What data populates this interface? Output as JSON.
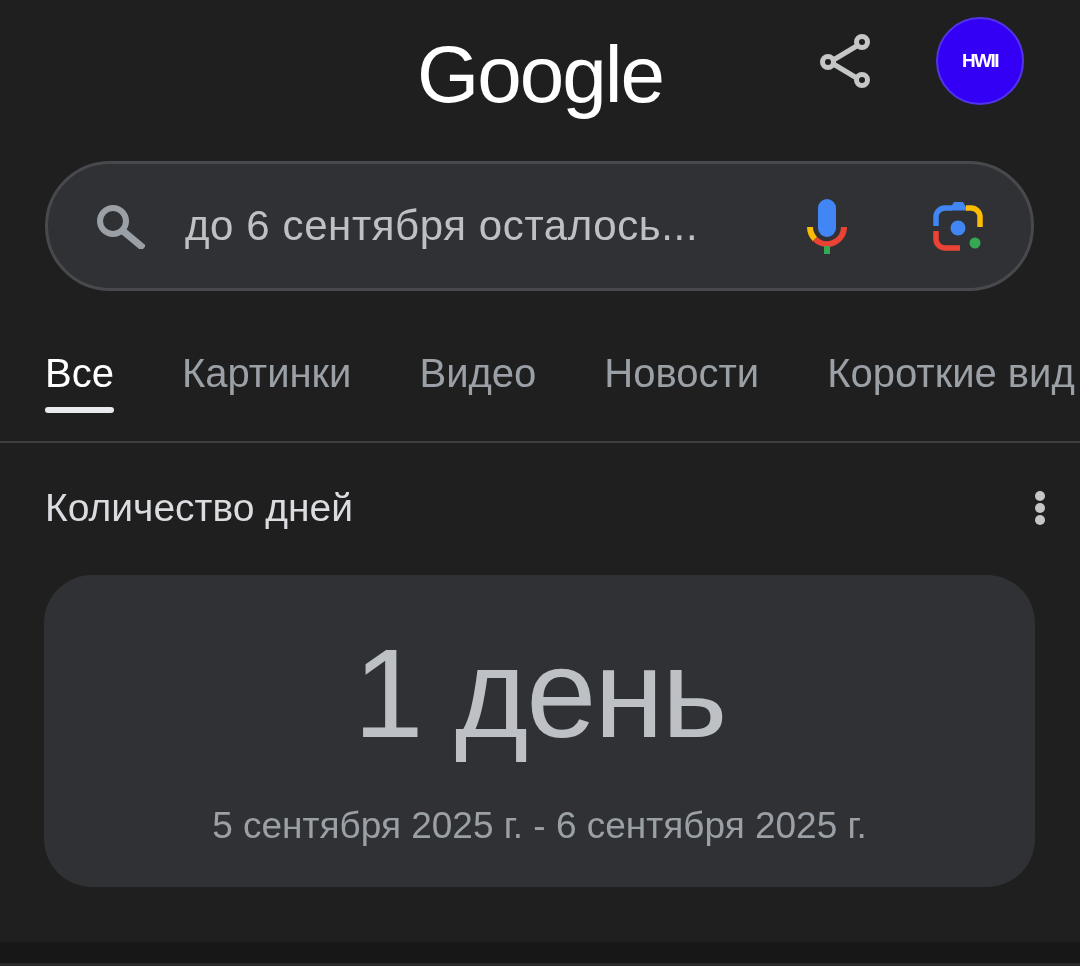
{
  "header": {
    "logo": "Google",
    "avatar": "HWII"
  },
  "search": {
    "value": "до 6 сентября осталось..."
  },
  "tabs": [
    {
      "label": "Все",
      "selected": true
    },
    {
      "label": "Картинки",
      "selected": false
    },
    {
      "label": "Видео",
      "selected": false
    },
    {
      "label": "Новости",
      "selected": false
    },
    {
      "label": "Короткие вид",
      "selected": false
    }
  ],
  "result": {
    "title": "Количество дней",
    "answer": "1 день",
    "date_range": "5 сентября 2025 г. - 6 сентября 2025 г."
  }
}
